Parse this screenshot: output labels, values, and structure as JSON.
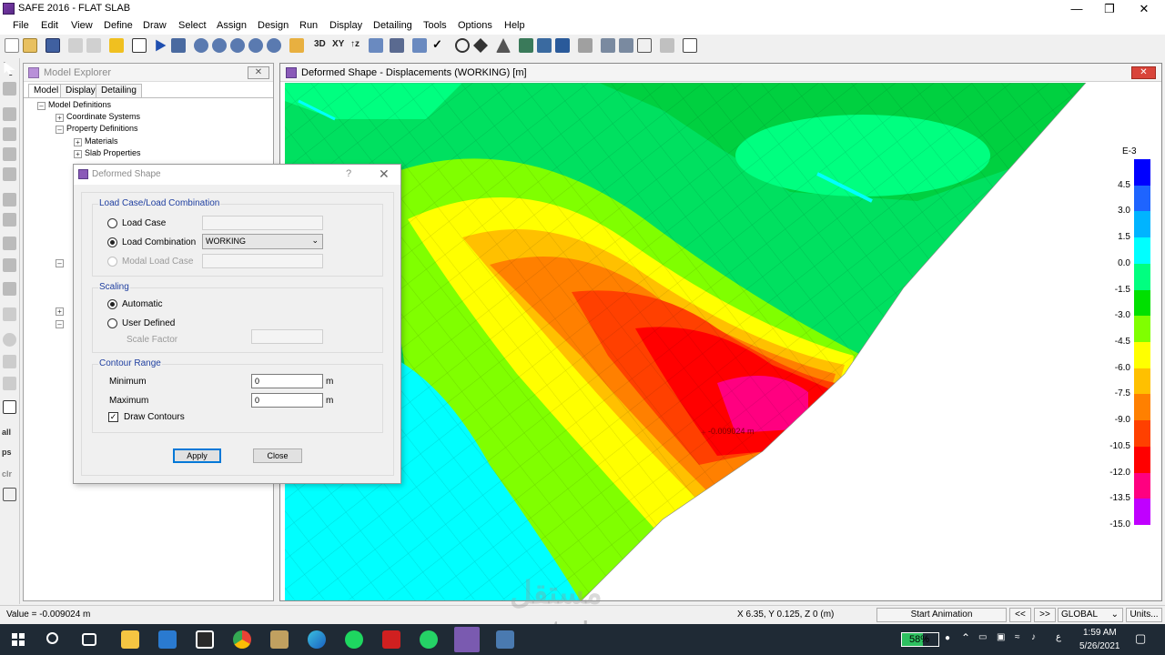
{
  "app": {
    "title": "SAFE 2016 - FLAT SLAB",
    "window_controls": [
      "minimize-icon",
      "restore-icon",
      "close-icon"
    ]
  },
  "menu": [
    "File",
    "Edit",
    "View",
    "Define",
    "Draw",
    "Select",
    "Assign",
    "Design",
    "Run",
    "Display",
    "Detailing",
    "Tools",
    "Options",
    "Help"
  ],
  "toolbar": {
    "view_3d": "3D",
    "view_xy": "XY",
    "view_z": "↑z"
  },
  "left_tools": {
    "all": "all",
    "ps": "ps",
    "clr": "clr"
  },
  "explorer": {
    "title": "Model Explorer",
    "tabs": [
      "Model",
      "Display",
      "Detailing"
    ],
    "tree": [
      "Model Definitions",
      "Coordinate Systems",
      "Property Definitions",
      "Materials",
      "Slab Properties"
    ]
  },
  "dialog": {
    "title": "Deformed Shape",
    "help": "?",
    "case_group": {
      "label": "Load Case/Load Combination",
      "load_case": "Load Case",
      "load_combination": "Load Combination",
      "combination_value": "WORKING",
      "modal_load_case": "Modal Load Case",
      "selected": "Load Combination"
    },
    "scaling_group": {
      "label": "Scaling",
      "automatic": "Automatic",
      "user_defined": "User Defined",
      "scale_factor": "Scale Factor",
      "selected": "Automatic"
    },
    "contour_group": {
      "label": "Contour Range",
      "minimum_label": "Minimum",
      "minimum_value": "0",
      "maximum_label": "Maximum",
      "maximum_value": "0",
      "unit": "m",
      "draw_contours": "Draw Contours",
      "draw_contours_checked": true
    },
    "apply": "Apply",
    "close": "Close"
  },
  "viewport": {
    "title": "Deformed Shape - Displacements (WORKING)  [m]",
    "point_label": "-0.009024 m",
    "legend": {
      "exponent": "E-3",
      "ticks": [
        "4.5",
        "3.0",
        "1.5",
        "0.0",
        "-1.5",
        "-3.0",
        "-4.5",
        "-6.0",
        "-7.5",
        "-9.0",
        "-10.5",
        "-12.0",
        "-13.5",
        "-15.0"
      ],
      "colors": [
        "#0000ff",
        "#1e64ff",
        "#00b4ff",
        "#00ffff",
        "#00ff80",
        "#00e000",
        "#80ff00",
        "#ffff00",
        "#ffc000",
        "#ff8000",
        "#ff4000",
        "#ff0000",
        "#ff0080",
        "#c000ff"
      ]
    }
  },
  "status": {
    "value": "Value = -0.009024 m",
    "coords": "X 6.35,  Y 0.125,  Z 0  (m)",
    "start_animation": "Start Animation",
    "prev": "<<",
    "next": ">>",
    "coord_system": "GLOBAL",
    "units": "Units..."
  },
  "watermark": {
    "arabic": "مستقل",
    "latin": "mostaql.com"
  },
  "taskbar": {
    "battery": "58%",
    "lang": "ع",
    "time": "1:59 AM",
    "date": "5/26/2021"
  }
}
